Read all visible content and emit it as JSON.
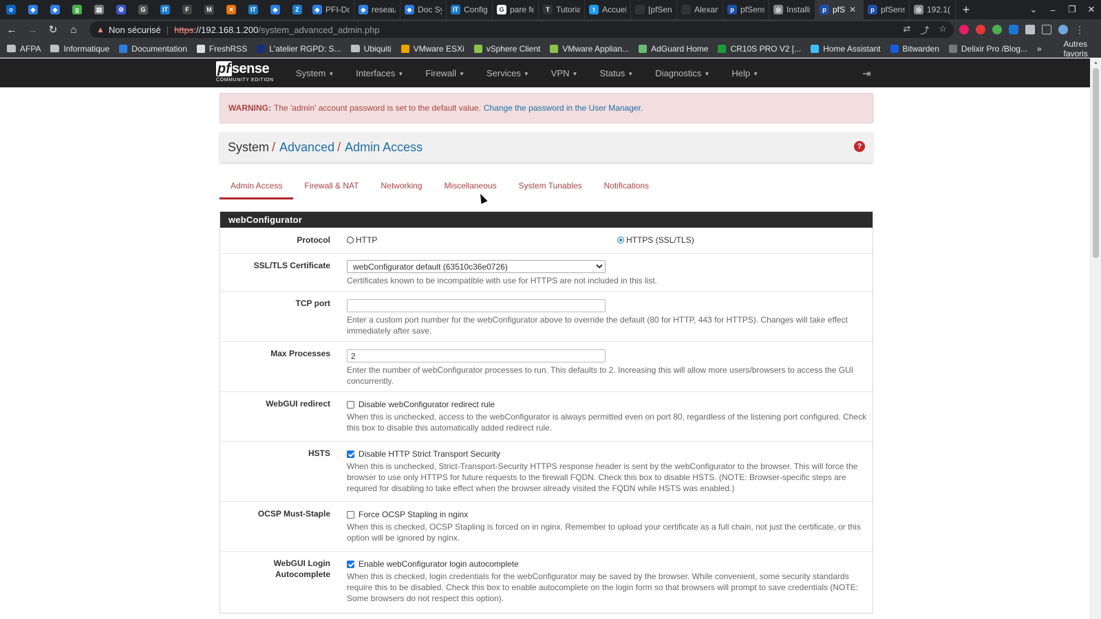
{
  "browser": {
    "tabs": [
      {
        "title": "",
        "color": "#0b66c3",
        "glyph": "o"
      },
      {
        "title": "",
        "color": "#2d7de0",
        "glyph": "◆"
      },
      {
        "title": "",
        "color": "#2d7de0",
        "glyph": "◆"
      },
      {
        "title": "",
        "color": "#4caf50",
        "glyph": "g"
      },
      {
        "title": "",
        "color": "#777",
        "glyph": "▤"
      },
      {
        "title": "",
        "color": "#3a57c7",
        "glyph": "⚙"
      },
      {
        "title": "",
        "color": "#555",
        "glyph": "G"
      },
      {
        "title": "",
        "color": "#1b7bc8",
        "glyph": "IT"
      },
      {
        "title": "",
        "color": "#444",
        "glyph": "F"
      },
      {
        "title": "",
        "color": "#444",
        "glyph": "M"
      },
      {
        "title": "",
        "color": "#e8710a",
        "glyph": "✕"
      },
      {
        "title": "",
        "color": "#1b7bc8",
        "glyph": "IT"
      },
      {
        "title": "",
        "color": "#2d7de0",
        "glyph": "◆"
      },
      {
        "title": "",
        "color": "#1b7bc8",
        "glyph": "Z"
      },
      {
        "title": "PFI-Do",
        "color": "#2d7de0",
        "glyph": "◆"
      },
      {
        "title": "reseau",
        "color": "#2d7de0",
        "glyph": "◆"
      },
      {
        "title": "Doc Sy",
        "color": "#2d7de0",
        "glyph": "◆"
      },
      {
        "title": "Config",
        "color": "#1b7bc8",
        "glyph": "IT"
      },
      {
        "title": "pare fe",
        "color": "#fff",
        "glyph": "G"
      },
      {
        "title": "Tutoria",
        "color": "#333",
        "glyph": "T"
      },
      {
        "title": "Accuei",
        "color": "#1d9bf0",
        "glyph": "t"
      },
      {
        "title": "[pfSen",
        "color": "#333",
        "glyph": ""
      },
      {
        "title": "Alexan",
        "color": "#333",
        "glyph": ""
      },
      {
        "title": "pfSens",
        "color": "#1e4fa8",
        "glyph": "p"
      },
      {
        "title": "Installi",
        "color": "#888",
        "glyph": "◎"
      },
      {
        "title": "pfS",
        "color": "#1e4fa8",
        "glyph": "p"
      },
      {
        "title": "pfSens",
        "color": "#1e4fa8",
        "glyph": "p"
      },
      {
        "title": "192.1(",
        "color": "#888",
        "glyph": "◎"
      }
    ],
    "active_tab_index": 25,
    "new_tab_label": "+",
    "security_warning": "Non sécurisé",
    "url_scheme": "https",
    "url_host": "://192.168.1.200",
    "url_path": "/system_advanced_admin.php",
    "bookmarks": [
      {
        "label": "AFPA",
        "type": "folder"
      },
      {
        "label": "Informatique",
        "type": "folder"
      },
      {
        "label": "Documentation",
        "type": "site",
        "color": "#2d7de0"
      },
      {
        "label": "FreshRSS",
        "type": "site",
        "color": "#ddd"
      },
      {
        "label": "L'atelier RGPD: S...",
        "type": "site",
        "color": "#1a2f7a"
      },
      {
        "label": "Ubiquiti",
        "type": "folder"
      },
      {
        "label": "VMware ESXi",
        "type": "site",
        "color": "#e8a600"
      },
      {
        "label": "vSphere Client",
        "type": "site",
        "color": "#8bc34a"
      },
      {
        "label": "VMware Applian...",
        "type": "site",
        "color": "#8bc34a"
      },
      {
        "label": "AdGuard Home",
        "type": "site",
        "color": "#68bc71"
      },
      {
        "label": "CR10S PRO V2 [...",
        "type": "site",
        "color": "#1c9a3b"
      },
      {
        "label": "Home Assistant",
        "type": "site",
        "color": "#41bdf5"
      },
      {
        "label": "Bitwarden",
        "type": "site",
        "color": "#175ddc"
      },
      {
        "label": "Delixir Pro /Blog...",
        "type": "site",
        "color": "#777"
      }
    ],
    "bookmarks_more": "»",
    "bookmarks_other": "Autres favoris"
  },
  "pfsense": {
    "logo_pf": "pf",
    "logo_sense": "sense",
    "logo_edition": "COMMUNITY EDITION",
    "menu": [
      "System",
      "Interfaces",
      "Firewall",
      "Services",
      "VPN",
      "Status",
      "Diagnostics",
      "Help"
    ],
    "logout_icon": "logout-icon",
    "alert": {
      "label": "WARNING:",
      "text": "The 'admin' account password is set to the default value.",
      "link": "Change the password in the User Manager."
    },
    "breadcrumb": {
      "root": "System",
      "sep": "/",
      "level2": "Advanced",
      "level3": "Admin Access",
      "help_glyph": "?"
    },
    "tabs": [
      {
        "label": "Admin Access",
        "active": true
      },
      {
        "label": "Firewall & NAT",
        "active": false
      },
      {
        "label": "Networking",
        "active": false
      },
      {
        "label": "Miscellaneous",
        "active": false
      },
      {
        "label": "System Tunables",
        "active": false
      },
      {
        "label": "Notifications",
        "active": false
      }
    ],
    "panel_title": "webConfigurator",
    "protocol": {
      "label": "Protocol",
      "option_http": "HTTP",
      "option_https": "HTTPS (SSL/TLS)",
      "selected": "HTTPS (SSL/TLS)"
    },
    "ssl_cert": {
      "label": "SSL/TLS Certificate",
      "value": "webConfigurator default (63510c36e0726)",
      "help": "Certificates known to be incompatible with use for HTTPS are not included in this list."
    },
    "tcp_port": {
      "label": "TCP port",
      "value": "",
      "help": "Enter a custom port number for the webConfigurator above to override the default (80 for HTTP, 443 for HTTPS). Changes will take effect immediately after save."
    },
    "max_processes": {
      "label": "Max Processes",
      "value": "2",
      "help": "Enter the number of webConfigurator processes to run. This defaults to 2. Increasing this will allow more users/browsers to access the GUI concurrently."
    },
    "webgui_redirect": {
      "label": "WebGUI redirect",
      "checkbox_label": "Disable webConfigurator redirect rule",
      "checked": false,
      "help": "When this is unchecked, access to the webConfigurator is always permitted even on port 80, regardless of the listening port configured. Check this box to disable this automatically added redirect rule."
    },
    "hsts": {
      "label": "HSTS",
      "checkbox_label": "Disable HTTP Strict Transport Security",
      "checked": true,
      "help": "When this is unchecked, Strict-Transport-Security HTTPS response header is sent by the webConfigurator to the browser. This will force the browser to use only HTTPS for future requests to the firewall FQDN. Check this box to disable HSTS. (NOTE: Browser-specific steps are required for disabling to take effect when the browser already visited the FQDN while HSTS was enabled.)"
    },
    "ocsp": {
      "label": "OCSP Must-Staple",
      "checkbox_label": "Force OCSP Stapling in nginx",
      "checked": false,
      "help": "When this is checked, OCSP Stapling is forced on in nginx. Remember to upload your certificate as a full chain, not just the certificate, or this option will be ignored by nginx."
    },
    "login_autocomplete": {
      "label_line1": "WebGUI Login",
      "label_line2": "Autocomplete",
      "checkbox_label": "Enable webConfigurator login autocomplete",
      "checked": true,
      "help": "When this is checked, login credentials for the webConfigurator may be saved by the browser. While convenient, some security standards require this to be disabled. Check this box to enable autocomplete on the login form so that browsers will prompt to save credentials (NOTE: Some browsers do not respect this option)."
    }
  }
}
